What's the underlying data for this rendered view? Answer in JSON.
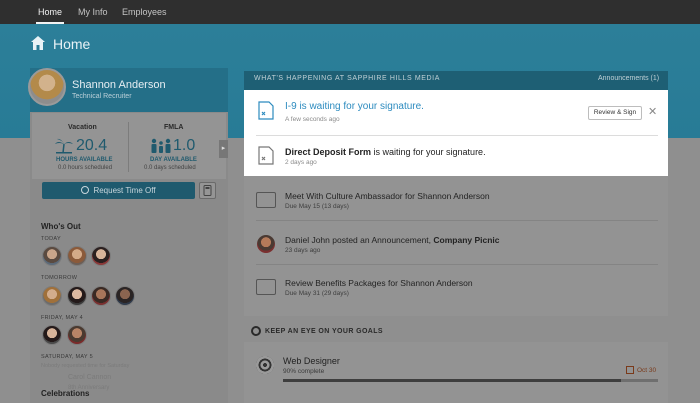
{
  "nav": {
    "items": [
      {
        "label": "Home",
        "active": true
      },
      {
        "label": "My Info"
      },
      {
        "label": "Employees"
      }
    ]
  },
  "page": {
    "title": "Home"
  },
  "profile": {
    "name": "Shannon Anderson",
    "role": "Technical Recruiter"
  },
  "vacation": {
    "label": "Vacation",
    "value": "20.4",
    "unit": "HOURS AVAILABLE",
    "scheduled": "0.0 hours scheduled"
  },
  "fmla": {
    "label": "FMLA",
    "value": "1.0",
    "unit": "DAY AVAILABLE",
    "scheduled": "0.0 days scheduled"
  },
  "request_btn": "Request Time Off",
  "whos_out": {
    "title": "Who's Out",
    "days": [
      {
        "label": "TODAY"
      },
      {
        "label": "TOMORROW"
      },
      {
        "label": "FRIDAY, MAY 4"
      },
      {
        "label": "SATURDAY, MAY 5"
      }
    ],
    "faded_name": "Carol Cannon",
    "faded_sub": "Nobody requested time for Saturday",
    "anniversary": "8th Anniversary"
  },
  "celebrations": "Celebrations",
  "panel": {
    "title": "WHAT'S HAPPENING AT SAPPHIRE HILLS MEDIA",
    "announcements": "Announcements (1)"
  },
  "feed": [
    {
      "title": "I-9 is waiting for your signature.",
      "time": "A few seconds ago",
      "action": "Review & Sign"
    },
    {
      "title_bold": "Direct Deposit Form",
      "title_rest": " is waiting for your signature.",
      "time": "2 days ago"
    },
    {
      "title": "Meet With Culture Ambassador for Shannon Anderson",
      "time": "Due May 15 (13 days)"
    },
    {
      "title_rest": "Daniel John posted an Announcement, ",
      "title_bold": "Company Picnic",
      "time": "23 days ago"
    },
    {
      "title": "Review Benefits Packages for Shannon Anderson",
      "time": "Due May 31 (29 days)"
    }
  ],
  "goals": {
    "section_title": "KEEP AN EYE ON YOUR GOALS",
    "name": "Web Designer",
    "progress_text": "90% complete",
    "progress": 0.9,
    "due": "Oct 30"
  },
  "colors": {
    "accent": "#1f5a6e",
    "link": "#2c8bbf"
  }
}
